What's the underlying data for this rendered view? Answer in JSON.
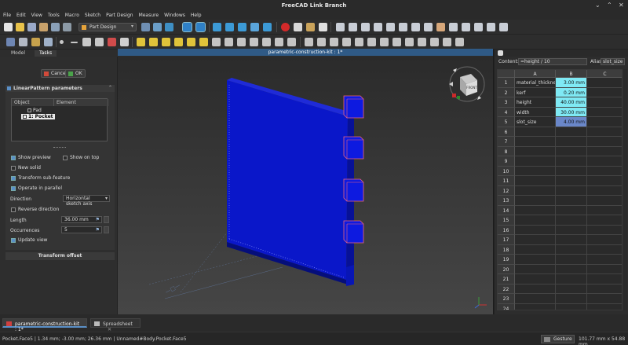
{
  "window": {
    "title": "FreeCAD Link Branch",
    "controls": [
      "⌄",
      "⌃",
      "✕"
    ]
  },
  "menu": [
    "File",
    "Edit",
    "View",
    "Tools",
    "Macro",
    "Sketch",
    "Part Design",
    "Measure",
    "Windows",
    "Help"
  ],
  "workbench": {
    "selected": "Part Design"
  },
  "combo": {
    "tabs": [
      "Model",
      "Tasks"
    ],
    "document_title": "parametric-construction-kit : 1*",
    "cancel_label": "Cancel",
    "ok_label": "OK",
    "panel_title": "LinearPattern parameters",
    "list_headers": [
      "Object",
      "Element"
    ],
    "list_items": [
      "Pad",
      "1: Pocket"
    ],
    "checkboxes": {
      "show_preview": "Show preview",
      "show_on_top": "Show on top",
      "new_solid": "New solid",
      "transform_subfeature": "Transform sub-feature",
      "operate_parallel": "Operate in parallel",
      "reverse_direction": "Reverse direction",
      "update_view": "Update view"
    },
    "direction_label": "Direction",
    "direction_value": "Horizontal sketch axis",
    "length_label": "Length",
    "length_value": "36.00 mm",
    "occurrences_label": "Occurrences",
    "occurrences_value": "5",
    "transform_offset": "Transform offset"
  },
  "navcube": {
    "face_label": "FRONT"
  },
  "spreadsheet": {
    "content_label": "Content:",
    "content_value": "=height / 10",
    "alias_label": "Alias:",
    "alias_value": "slot_size",
    "columns": [
      "A",
      "B",
      "C"
    ],
    "rows": [
      {
        "n": "1",
        "a": "material_thickness",
        "b": "3.00 mm"
      },
      {
        "n": "2",
        "a": "kerf",
        "b": "0.20 mm"
      },
      {
        "n": "3",
        "a": "height",
        "b": "40.00 mm"
      },
      {
        "n": "4",
        "a": "width",
        "b": "30.00 mm"
      },
      {
        "n": "5",
        "a": "slot_size",
        "b": "4.00 mm"
      },
      {
        "n": "6",
        "a": "",
        "b": ""
      },
      {
        "n": "7",
        "a": "",
        "b": ""
      },
      {
        "n": "8",
        "a": "",
        "b": ""
      },
      {
        "n": "9",
        "a": "",
        "b": ""
      },
      {
        "n": "10",
        "a": "",
        "b": ""
      },
      {
        "n": "11",
        "a": "",
        "b": ""
      },
      {
        "n": "12",
        "a": "",
        "b": ""
      },
      {
        "n": "13",
        "a": "",
        "b": ""
      },
      {
        "n": "14",
        "a": "",
        "b": ""
      },
      {
        "n": "15",
        "a": "",
        "b": ""
      },
      {
        "n": "16",
        "a": "",
        "b": ""
      },
      {
        "n": "17",
        "a": "",
        "b": ""
      },
      {
        "n": "18",
        "a": "",
        "b": ""
      },
      {
        "n": "19",
        "a": "",
        "b": ""
      },
      {
        "n": "20",
        "a": "",
        "b": ""
      },
      {
        "n": "21",
        "a": "",
        "b": ""
      },
      {
        "n": "22",
        "a": "",
        "b": ""
      },
      {
        "n": "23",
        "a": "",
        "b": ""
      },
      {
        "n": "24",
        "a": "",
        "b": ""
      }
    ]
  },
  "doc_tabs": [
    "parametric-construction-kit : 1*",
    "Spreadsheet"
  ],
  "status": {
    "left": "Pocket.Face5 | 1.34 mm; -3.00 mm; 26.36 mm | Unnamed#Body.Pocket.Face5",
    "gesture_label": "Gesture",
    "dimensions": "101.77 mm x 54.88 mm"
  },
  "colors": {
    "accent": "#5a8fc7",
    "part_blue": "#0a17c9",
    "cell_highlight": "#7fe9f4",
    "selected_cell": "#6a87c9"
  }
}
